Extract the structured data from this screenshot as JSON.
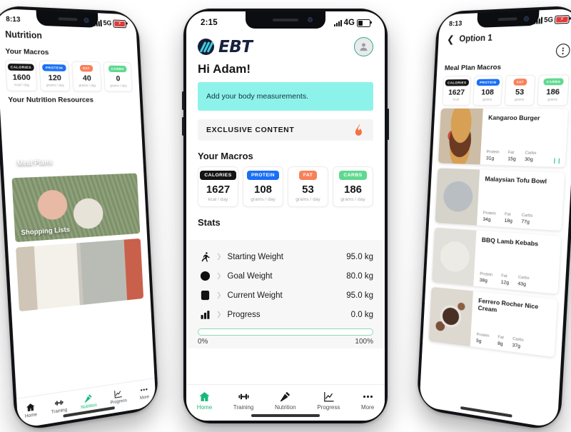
{
  "colors": {
    "calories": "#141414",
    "protein": "#1a6ff5",
    "fat": "#f98058",
    "carbs": "#5fd98f",
    "accent_green": "#17b877",
    "cyan_card": "#8df3ea",
    "brand_navy": "#161e38"
  },
  "center_phone": {
    "status": {
      "time": "2:15",
      "network": "4G"
    },
    "brand": {
      "logo_text": "EBT"
    },
    "greeting": "Hi Adam!",
    "notice": "Add your body measurements.",
    "exclusive": {
      "label": "EXCLUSIVE CONTENT",
      "icon": "flame-icon"
    },
    "macros_title": "Your Macros",
    "macros": [
      {
        "badge": "CALORIES",
        "value": "1627",
        "unit": "kcal / day"
      },
      {
        "badge": "PROTEIN",
        "value": "108",
        "unit": "grams / day"
      },
      {
        "badge": "FAT",
        "value": "53",
        "unit": "grams / day"
      },
      {
        "badge": "CARBS",
        "value": "186",
        "unit": "grams / day"
      }
    ],
    "stats_title": "Stats",
    "stats": [
      {
        "icon": "runner-icon",
        "label": "Starting Weight",
        "value": "95.0 kg"
      },
      {
        "icon": "target-icon",
        "label": "Goal Weight",
        "value": "80.0 kg"
      },
      {
        "icon": "scale-icon",
        "label": "Current Weight",
        "value": "95.0 kg"
      },
      {
        "icon": "bar-chart-icon",
        "label": "Progress",
        "value": "0.0 kg"
      }
    ],
    "progress": {
      "min_label": "0%",
      "max_label": "100%",
      "percent": 0
    },
    "nav": [
      {
        "label": "Home",
        "icon": "home-icon",
        "active": true
      },
      {
        "label": "Training",
        "icon": "dumbbell-icon",
        "active": false
      },
      {
        "label": "Nutrition",
        "icon": "carrot-icon",
        "active": false
      },
      {
        "label": "Progress",
        "icon": "chart-line-icon",
        "active": false
      },
      {
        "label": "More",
        "icon": "ellipsis-icon",
        "active": false
      }
    ]
  },
  "left_phone": {
    "status": {
      "time": "8:13",
      "network": "5G"
    },
    "title": "Nutrition",
    "macros_title": "Your Macros",
    "macros": [
      {
        "badge": "CALORIES",
        "value": "1600",
        "unit": "kcal / day"
      },
      {
        "badge": "PROTEIN",
        "value": "120",
        "unit": "grams / day"
      },
      {
        "badge": "FAT",
        "value": "40",
        "unit": "grams / day"
      },
      {
        "badge": "CARBS",
        "value": "0",
        "unit": "grams / day"
      }
    ],
    "resources_title": "Your Nutrition Resources",
    "resources": [
      {
        "label": "Meal Plans",
        "image": "salad-bowl-photo"
      },
      {
        "label": "Shopping Lists",
        "image": "grocery-bag-photo"
      },
      {
        "label": "",
        "image": "cookbook-photo"
      }
    ],
    "nav": [
      {
        "label": "Home",
        "icon": "home-icon",
        "active": false
      },
      {
        "label": "Training",
        "icon": "dumbbell-icon",
        "active": false
      },
      {
        "label": "Nutrition",
        "icon": "carrot-icon",
        "active": true
      },
      {
        "label": "Progress",
        "icon": "chart-line-icon",
        "active": false
      },
      {
        "label": "More",
        "icon": "ellipsis-icon",
        "active": false
      }
    ]
  },
  "right_phone": {
    "status": {
      "time": "8:13",
      "network": "5G"
    },
    "title": "Option 1",
    "macros_title": "Meal Plan Macros",
    "macros": [
      {
        "badge": "CALORIES",
        "value": "1627",
        "unit": "kcal"
      },
      {
        "badge": "PROTEIN",
        "value": "108",
        "unit": "grams"
      },
      {
        "badge": "FAT",
        "value": "53",
        "unit": "grams"
      },
      {
        "badge": "CARBS",
        "value": "186",
        "unit": "grams"
      }
    ],
    "macro_keys": {
      "protein": "Protein",
      "fat": "Fat",
      "carbs": "Carbs"
    },
    "meals": [
      {
        "name": "Kangaroo Burger",
        "protein": "31g",
        "fat": "15g",
        "carbs": "30g",
        "image": "burger-photo",
        "badge": "leaf-icon"
      },
      {
        "name": "Malaysian Tofu Bowl",
        "protein": "34g",
        "fat": "18g",
        "carbs": "77g",
        "image": "tofu-bowl-photo",
        "badge": ""
      },
      {
        "name": "BBQ Lamb Kebabs",
        "protein": "38g",
        "fat": "12g",
        "carbs": "43g",
        "image": "kebab-photo",
        "badge": ""
      },
      {
        "name": "Ferrero Rocher Nice Cream",
        "protein": "5g",
        "fat": "8g",
        "carbs": "37g",
        "image": "icecream-photo",
        "badge": ""
      }
    ]
  }
}
